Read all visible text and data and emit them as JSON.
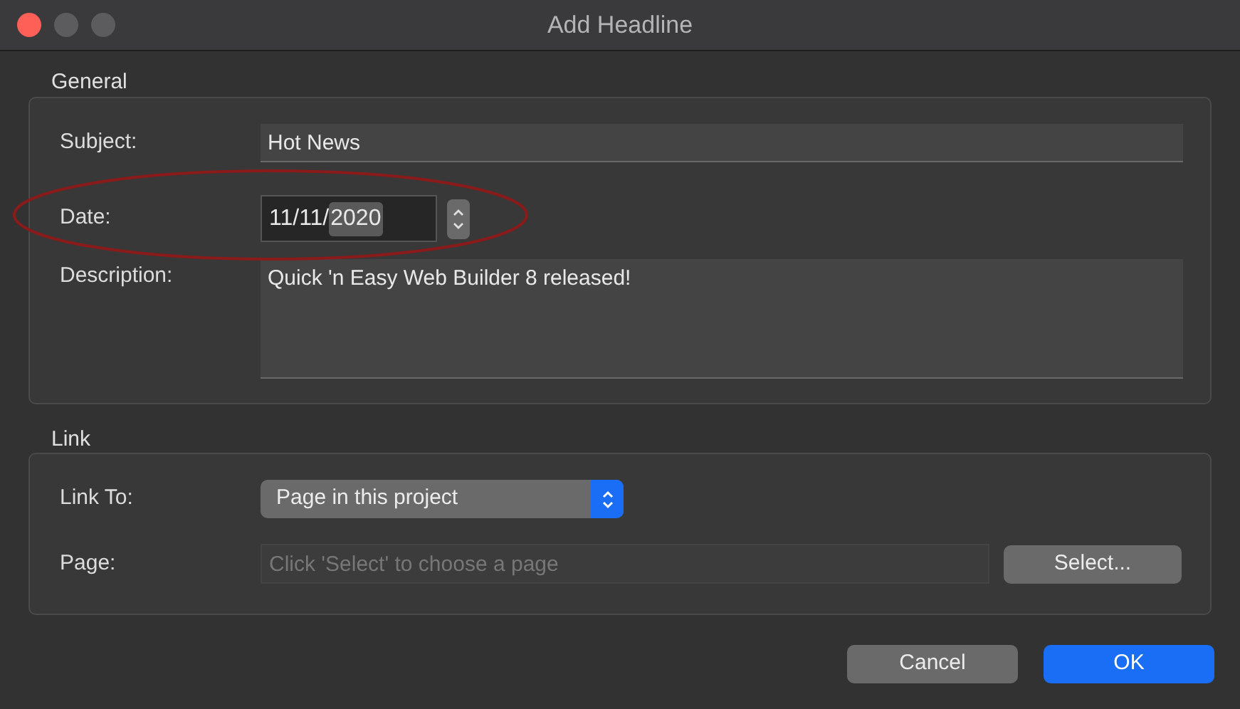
{
  "window": {
    "title": "Add Headline"
  },
  "general": {
    "title": "General",
    "subject": {
      "label": "Subject:",
      "value": "Hot News"
    },
    "date": {
      "label": "Date:",
      "parts": [
        {
          "text": "11/",
          "selected": false
        },
        {
          "text": "11/",
          "selected": false
        },
        {
          "text": "2020",
          "selected": true
        }
      ]
    },
    "description": {
      "label": "Description:",
      "value": "Quick 'n Easy Web Builder 8 released!"
    }
  },
  "link": {
    "title": "Link",
    "link_to": {
      "label": "Link To:",
      "value": "Page in this project"
    },
    "page": {
      "label": "Page:",
      "placeholder": "Click 'Select' to choose a page",
      "button": "Select..."
    }
  },
  "buttons": [
    {
      "label": "Cancel",
      "kind": "secondary"
    },
    {
      "label": "OK",
      "kind": "primary"
    }
  ]
}
